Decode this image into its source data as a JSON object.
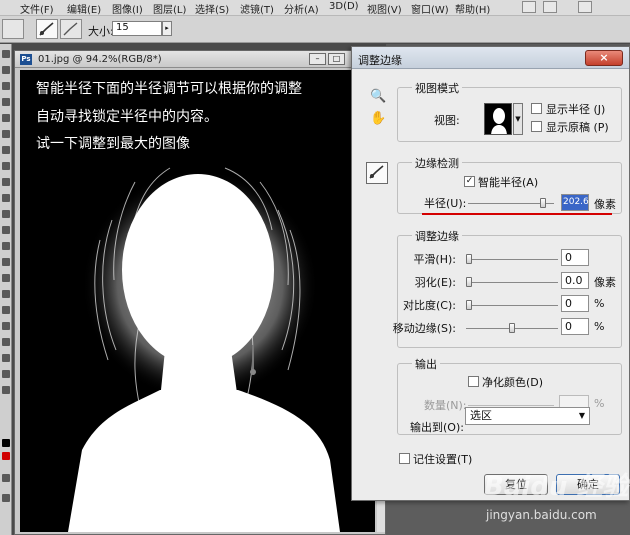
{
  "menubar": {
    "items": [
      "文件(F)",
      "编辑(E)",
      "图像(I)",
      "图层(L)",
      "选择(S)",
      "滤镜(T)",
      "分析(A)",
      "3D(D)",
      "视图(V)",
      "窗口(W)",
      "帮助(H)"
    ]
  },
  "options": {
    "size_label": "大小:",
    "size_value": "15"
  },
  "document": {
    "title": "01.jpg @ 94.2%(RGB/8*)",
    "ps_badge": "Ps",
    "annotations": [
      "智能半径下面的半径调节可以根据你的调整",
      "自动寻找锁定半径中的内容。",
      "试一下调整到最大的图像"
    ]
  },
  "dialog": {
    "title": "调整边缘",
    "close": "×",
    "view_mode": {
      "legend": "视图模式",
      "view_label": "视图:",
      "show_radius": "显示半径 (J)",
      "show_original": "显示原稿 (P)"
    },
    "edge_detection": {
      "legend": "边缘检测",
      "smart_radius": "智能半径(A)",
      "radius_label": "半径(U):",
      "radius_value": "202.6",
      "radius_unit": "像素",
      "radius_fraction": 0.9
    },
    "adjust_edge": {
      "legend": "调整边缘",
      "rows": [
        {
          "label": "平滑(H):",
          "value": "0",
          "unit": "",
          "fraction": 0.0
        },
        {
          "label": "羽化(E):",
          "value": "0.0",
          "unit": "像素",
          "fraction": 0.0
        },
        {
          "label": "对比度(C):",
          "value": "0",
          "unit": "%",
          "fraction": 0.0
        },
        {
          "label": "移动边缘(S):",
          "value": "0",
          "unit": "%",
          "fraction": 0.5
        }
      ]
    },
    "output": {
      "legend": "输出",
      "decontaminate": "净化颜色(D)",
      "amount_label": "数量(N):",
      "amount_unit": "%",
      "output_to_label": "输出到(O):",
      "output_to_value": "选区"
    },
    "remember": "记住设置(T)",
    "reset_button": "复位",
    "ok_button": "确定"
  },
  "watermark": {
    "logo": "Baidu 经验",
    "url": "jingyan.baidu.com"
  },
  "colors": {
    "annotation": "#ffffff",
    "highlight": "#3a66c7",
    "underline": "#d40000"
  }
}
